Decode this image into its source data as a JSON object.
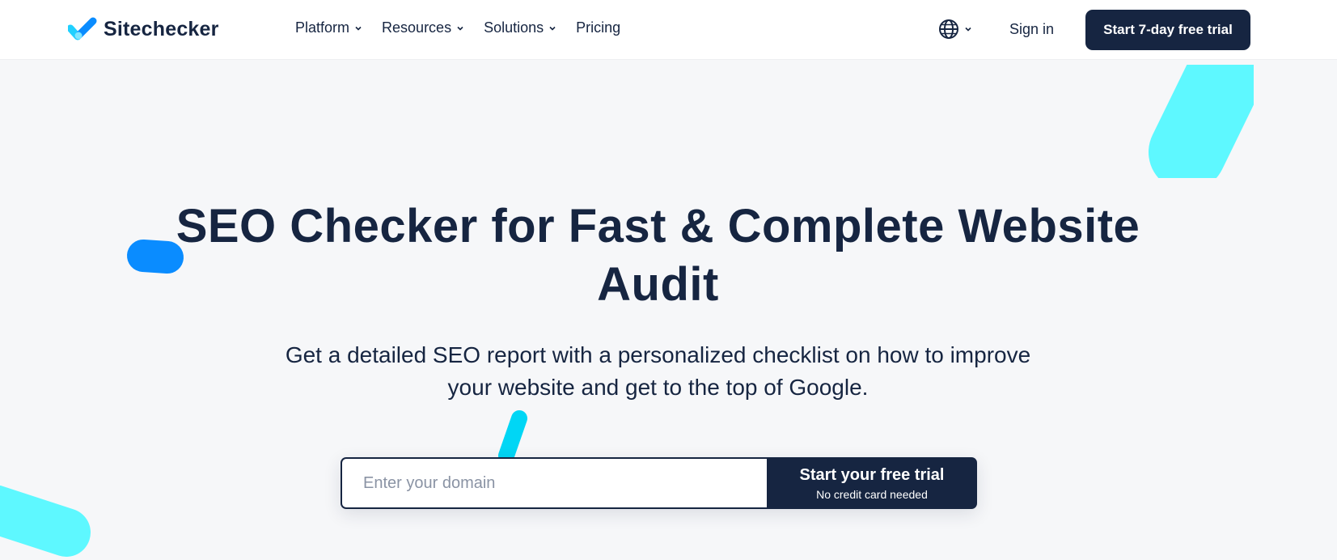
{
  "header": {
    "brand": "Sitechecker",
    "nav": [
      {
        "label": "Platform",
        "has_dropdown": true
      },
      {
        "label": "Resources",
        "has_dropdown": true
      },
      {
        "label": "Solutions",
        "has_dropdown": true
      },
      {
        "label": "Pricing",
        "has_dropdown": false
      }
    ],
    "language_icon": "globe-icon",
    "sign_in": "Sign in",
    "trial_button": "Start 7-day free trial"
  },
  "hero": {
    "title_line1": "SEO Checker for Fast & Complete Website",
    "title_line2": "Audit",
    "subtitle_line1": "Get a detailed SEO report with a personalized checklist on how to improve",
    "subtitle_line2": "your website and get to the top of Google."
  },
  "form": {
    "placeholder": "Enter your domain",
    "value": "",
    "cta_main": "Start your free trial",
    "cta_sub": "No credit card needed"
  },
  "colors": {
    "navy": "#162541",
    "cyan": "#5ef8ff",
    "blue": "#0a8cff",
    "background": "#f6f7f9"
  }
}
